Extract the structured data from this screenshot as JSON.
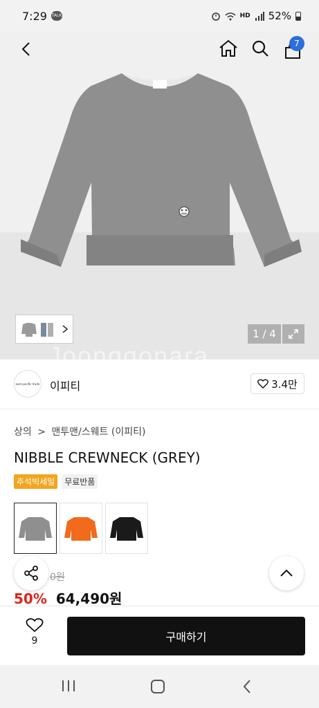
{
  "status": {
    "time": "7:29",
    "talk": "TALK",
    "network": "HD",
    "battery": "52%"
  },
  "header": {
    "cart_count": "7"
  },
  "gallery": {
    "page_indicator": "1 / 4",
    "watermark": "Joonggonara"
  },
  "brand": {
    "name": "이피티",
    "logo_text": "east pacific trade",
    "likes": "3.4만"
  },
  "breadcrumb": {
    "category": "상의",
    "separator": ">",
    "subcategory": "맨투맨/스웨트 (이피티)"
  },
  "product": {
    "title": "NIBBLE CREWNECK (GREY)",
    "tags": [
      "추석빅세일",
      "무료반품"
    ],
    "colors": [
      {
        "name": "grey",
        "hex": "#8f8f8f",
        "selected": true
      },
      {
        "name": "orange",
        "hex": "#f26a1b",
        "selected": false
      },
      {
        "name": "black",
        "hex": "#1a1a1a",
        "selected": false
      }
    ],
    "original_price": "0원",
    "discount": "50%",
    "price": "64,490원"
  },
  "bottom": {
    "wish_count": "9",
    "buy_label": "구매하기"
  },
  "colors": {
    "accent_badge": "#2a6fdb",
    "sale_tag": "#f3a51d",
    "discount": "#e0231b"
  }
}
